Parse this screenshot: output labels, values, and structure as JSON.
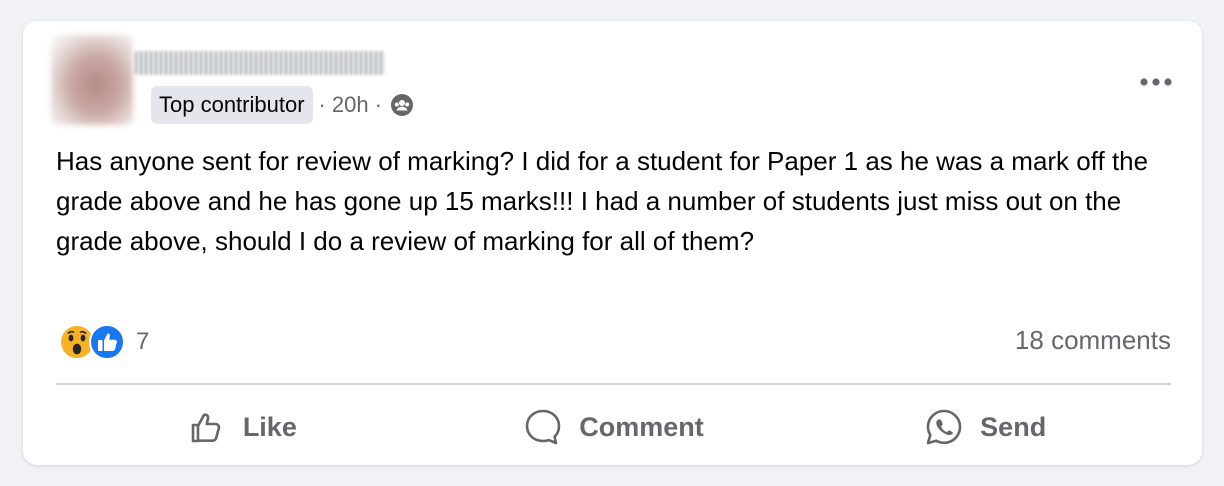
{
  "post": {
    "author": {
      "name_redacted": true,
      "badge": "Top contributor"
    },
    "separator": "·",
    "time": "20h",
    "audience_icon": "group-icon",
    "body": "Has anyone sent for review of marking? I did for a student for Paper 1 as he was a mark off the grade above and he has gone up 15 marks!!! I had a number of students just miss out on the grade above, should I do a review of marking for all of them?",
    "reactions": {
      "icons": [
        "wow-reaction-icon",
        "like-reaction-icon"
      ],
      "count": "7"
    },
    "comments_count": "18 comments",
    "actions": {
      "like": "Like",
      "comment": "Comment",
      "send": "Send"
    }
  },
  "colors": {
    "background": "#f0f2f5",
    "card": "#ffffff",
    "secondary_text": "#65676b",
    "like_blue": "#1877f2",
    "wow_yellow": "#f7b125"
  }
}
